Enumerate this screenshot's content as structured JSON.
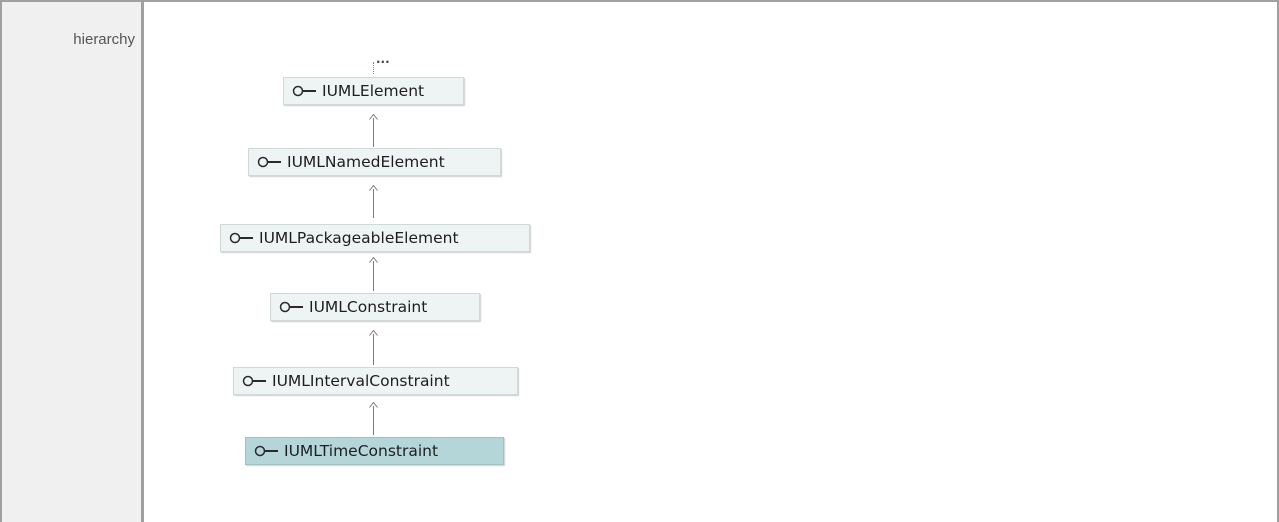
{
  "section": {
    "label": "hierarchy"
  },
  "hierarchy": {
    "more_indicator": "...",
    "nodes": [
      {
        "name": "IUMLElement",
        "selected": false
      },
      {
        "name": "IUMLNamedElement",
        "selected": false
      },
      {
        "name": "IUMLPackageableElement",
        "selected": false
      },
      {
        "name": "IUMLConstraint",
        "selected": false
      },
      {
        "name": "IUMLIntervalConstraint",
        "selected": false
      },
      {
        "name": "IUMLTimeConstraint",
        "selected": true
      }
    ],
    "node_icon": "interface-lollipop-icon"
  },
  "colors": {
    "node_bg": "#eef3f3",
    "selected_bg": "#b5d6d8",
    "label_bg": "#f0f0f0",
    "border": "#a0a0a0"
  }
}
